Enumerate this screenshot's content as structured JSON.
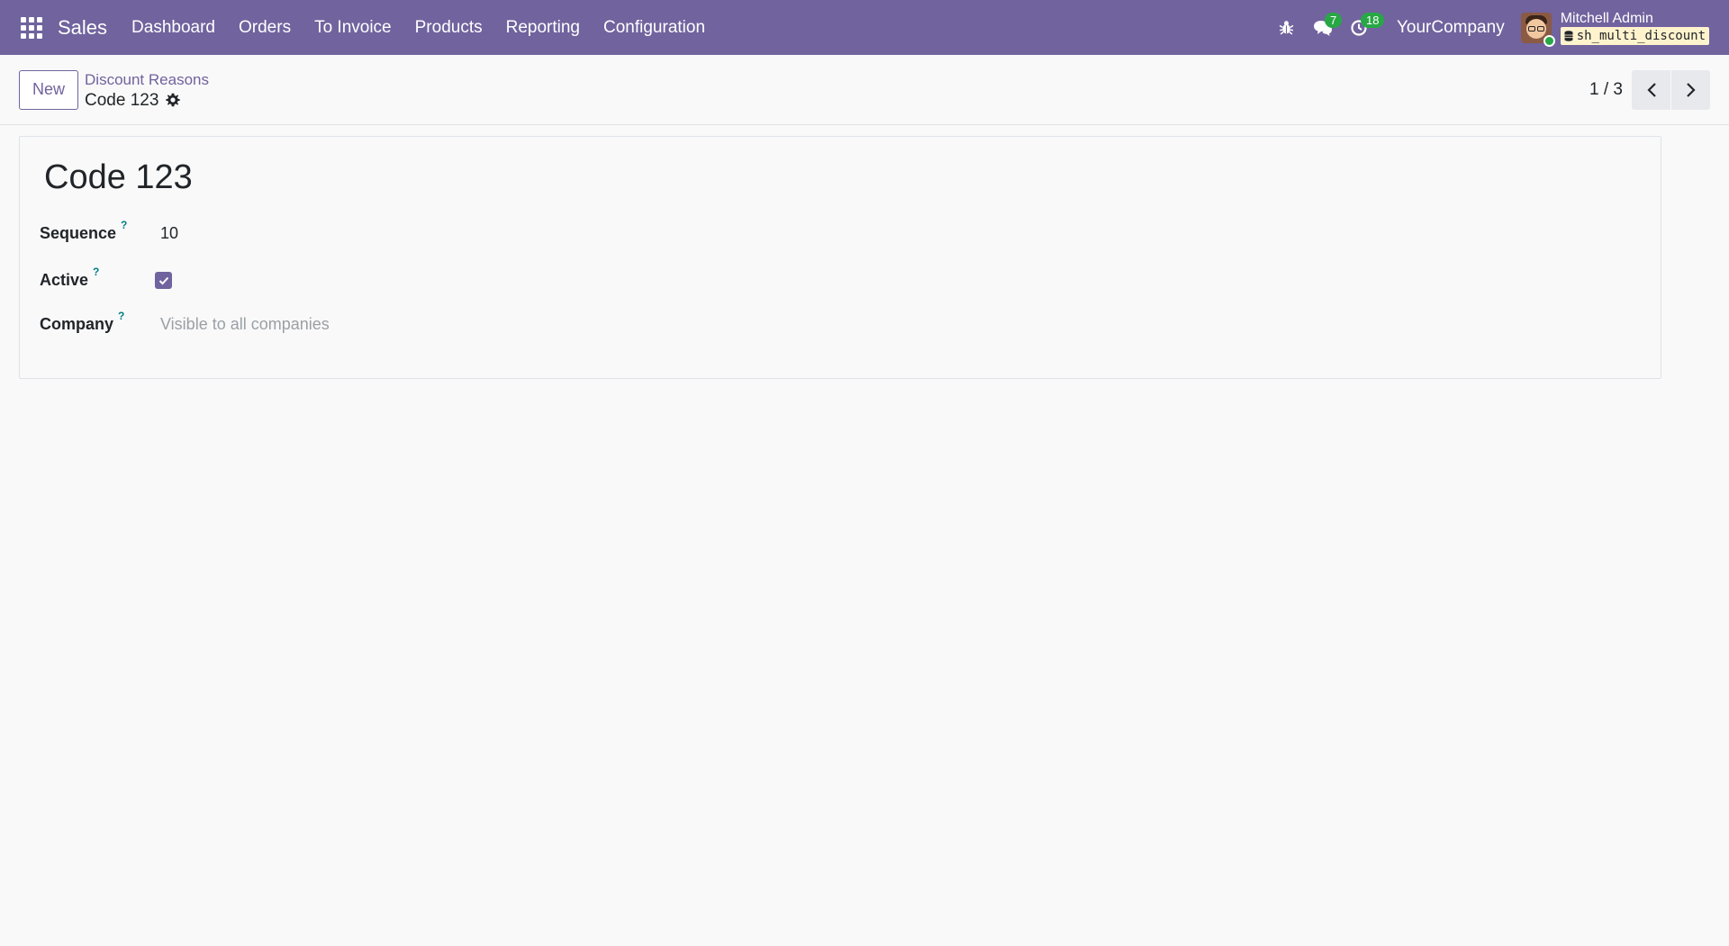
{
  "navbar": {
    "app_name": "Sales",
    "menu": [
      "Dashboard",
      "Orders",
      "To Invoice",
      "Products",
      "Reporting",
      "Configuration"
    ],
    "messages_count": "7",
    "activities_count": "18",
    "company": "YourCompany",
    "user_name": "Mitchell Admin",
    "database": "sh_multi_discount"
  },
  "control_panel": {
    "new_label": "New",
    "breadcrumb_parent": "Discount Reasons",
    "breadcrumb_current": "Code 123",
    "pager": "1 / 3"
  },
  "form": {
    "title": "Code 123",
    "sequence_label": "Sequence",
    "sequence_value": "10",
    "active_label": "Active",
    "active_value": true,
    "company_label": "Company",
    "company_placeholder": "Visible to all companies",
    "help_mark": "?"
  },
  "colors": {
    "brand": "#71639e",
    "badge": "#28a745",
    "help": "#017e84"
  }
}
